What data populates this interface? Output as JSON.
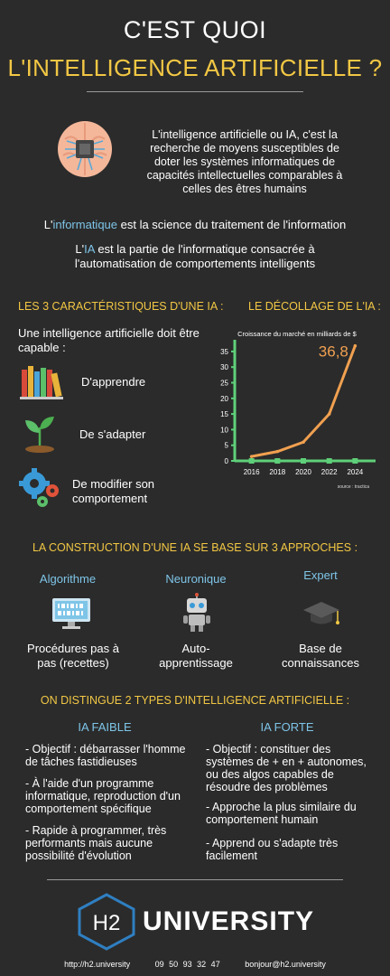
{
  "header": {
    "title_line1": "C'EST QUOI",
    "title_line2": "L'INTELLIGENCE ARTIFICIELLE ?"
  },
  "intro": {
    "text": "L'intelligence artificielle ou IA, c'est la recherche de moyens susceptibles de doter les systèmes informatiques de capacités intellectuelles comparables à celles des êtres humains"
  },
  "definitions": {
    "def1_prefix": "L'",
    "def1_term": "informatique",
    "def1_rest": " est la science du traitement de l'information",
    "def2_prefix": "L'",
    "def2_term": "IA",
    "def2_rest": " est la partie de l'informatique consacrée à l'automatisation de comportements intelligents"
  },
  "characteristics": {
    "title": "LES 3 CARACTÉRISTIQUES D'UNE IA :",
    "lead": "Une intelligence artificielle doit être capable :",
    "items": [
      "D'apprendre",
      "De s'adapter",
      "De modifier son comportement"
    ],
    "icons": [
      "books-icon",
      "sprout-icon",
      "gears-icon"
    ]
  },
  "takeoff": {
    "title": "LE DÉCOLLAGE DE L'IA :"
  },
  "chart_data": {
    "type": "line",
    "title": "Croissance du marché en milliards de $",
    "x": [
      2016,
      2018,
      2020,
      2022,
      2024
    ],
    "values": [
      1.4,
      3,
      6,
      15,
      36.8
    ],
    "annotation": "36,8",
    "source": "source : tractica",
    "ylim": [
      0,
      37
    ],
    "yticks": [
      0,
      5,
      10,
      15,
      20,
      25,
      30,
      35
    ],
    "xlabel": "",
    "ylabel": "",
    "colors": {
      "line": "#f0a050",
      "axis": "#5fd07a",
      "annotation": "#f0a050"
    }
  },
  "approaches": {
    "title": "LA CONSTRUCTION D'UNE IA SE BASE SUR 3 APPROCHES :",
    "items": [
      {
        "name": "Algorithme",
        "desc": "Procédures pas à pas (recettes)",
        "icon": "monitor-binary-icon"
      },
      {
        "name": "Neuronique",
        "desc": "Auto-apprentissage",
        "icon": "robot-icon"
      },
      {
        "name": "Expert",
        "desc": "Base de connaissances",
        "icon": "graduation-cap-icon"
      }
    ]
  },
  "types": {
    "title": "ON DISTINGUE 2 TYPES D'INTELLIGENCE ARTIFICIELLE :",
    "weak": {
      "name": "IA FAIBLE",
      "points": [
        "-   Objectif : débarrasser l'homme de tâches fastidieuses",
        "-   À l'aide d'un programme informatique, reproduction d'un comportement spécifique",
        "-   Rapide à programmer, très performants mais aucune possibilité d'évolution"
      ]
    },
    "strong": {
      "name": "IA FORTE",
      "points": [
        "-   Objectif : constituer des systèmes de + en + autonomes, ou des algos capables de résoudre des problèmes",
        "-   Approche la plus similaire du comportement humain",
        "-   Apprend ou s'adapte très facilement"
      ]
    }
  },
  "footer": {
    "logo_text": "H2",
    "brand": "UNIVERSITY",
    "url": "http://h2.university",
    "phone": "09 50 93 32 47",
    "email": "bonjour@h2.university"
  },
  "colors": {
    "background": "#2b2b2b",
    "accent_yellow": "#f2c744",
    "accent_blue": "#7ec5e8",
    "logo_blue": "#2f7fc1"
  }
}
